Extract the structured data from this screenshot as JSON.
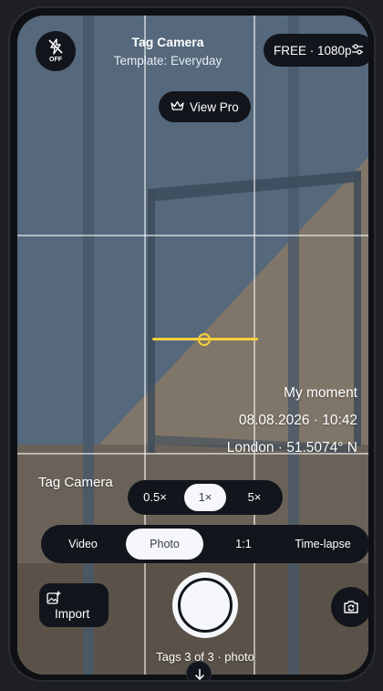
{
  "header": {
    "title": "Tag Camera",
    "template": "Template: Everyday",
    "flash_state": "OFF",
    "flash_icon": "flash-off-icon",
    "plan_label": "FREE · 1080p",
    "settings_icon": "sliders-icon"
  },
  "promo": {
    "label": "View Pro",
    "icon": "crown-icon"
  },
  "stamp": {
    "caption": "My moment",
    "datetime": "08.08.2026 · 10:42",
    "location": "London · 51.5074° N"
  },
  "watermark_label": "Tag Camera",
  "zoom": {
    "options": [
      "0.5×",
      "1×",
      "5×"
    ],
    "selected": "1×"
  },
  "modes": {
    "options": [
      "Video",
      "Photo",
      "1:1",
      "Time-lapse"
    ],
    "selected": "Photo"
  },
  "bottom": {
    "import_label": "Import",
    "import_icon": "image-add-icon",
    "flip_icon": "camera-flip-icon",
    "tags_status": "Tags 3 of 3 · photo",
    "collapse_icon": "chevron-down-icon"
  },
  "colors": {
    "level_indicator": "#f4cf3c",
    "control_background": "#12151b",
    "active_chip": "#f5f7fa"
  }
}
